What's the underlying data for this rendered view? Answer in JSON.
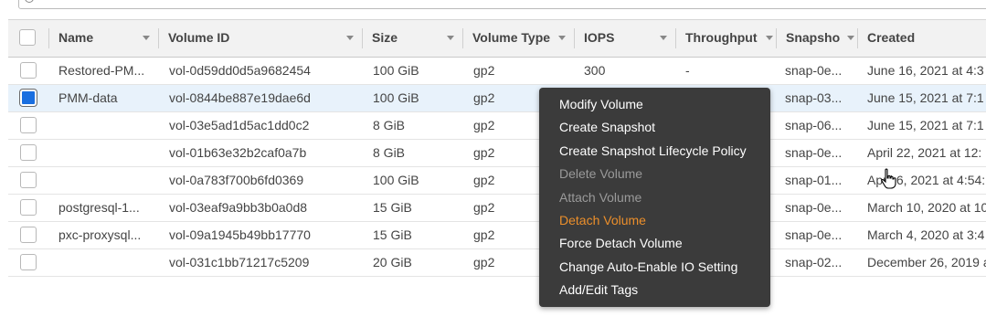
{
  "columns": [
    {
      "key": "name",
      "label": "Name"
    },
    {
      "key": "volume_id",
      "label": "Volume ID"
    },
    {
      "key": "size",
      "label": "Size"
    },
    {
      "key": "volume_type",
      "label": "Volume Type"
    },
    {
      "key": "iops",
      "label": "IOPS"
    },
    {
      "key": "throughput",
      "label": "Throughput"
    },
    {
      "key": "snapshot",
      "label": "Snapsho"
    },
    {
      "key": "created",
      "label": "Created"
    }
  ],
  "rows": [
    {
      "name": "Restored-PM...",
      "volume_id": "vol-0d59dd0d5a9682454",
      "size": "100 GiB",
      "volume_type": "gp2",
      "iops": "300",
      "throughput": "-",
      "snapshot": "snap-0e...",
      "created": "June 16, 2021 at 4:3",
      "selected": false
    },
    {
      "name": "PMM-data",
      "volume_id": "vol-0844be887e19dae6d",
      "size": "100 GiB",
      "volume_type": "gp2",
      "iops": "",
      "throughput": "",
      "snapshot": "snap-03...",
      "created": "June 15, 2021 at 7:1",
      "selected": true
    },
    {
      "name": "",
      "volume_id": "vol-03e5ad1d5ac1dd0c2",
      "size": "8 GiB",
      "volume_type": "gp2",
      "iops": "",
      "throughput": "",
      "snapshot": "snap-06...",
      "created": "June 15, 2021 at 7:1",
      "selected": false
    },
    {
      "name": "",
      "volume_id": "vol-01b63e32b2caf0a7b",
      "size": "8 GiB",
      "volume_type": "gp2",
      "iops": "",
      "throughput": "",
      "snapshot": "snap-0e...",
      "created": "April 22, 2021 at 12:",
      "selected": false
    },
    {
      "name": "",
      "volume_id": "vol-0a783f700b6fd0369",
      "size": "100 GiB",
      "volume_type": "gp2",
      "iops": "",
      "throughput": "",
      "snapshot": "snap-01...",
      "created": "April 6, 2021 at 4:54:",
      "selected": false
    },
    {
      "name": "postgresql-1...",
      "volume_id": "vol-03eaf9a9bb3b0a0d8",
      "size": "15 GiB",
      "volume_type": "gp2",
      "iops": "",
      "throughput": "",
      "snapshot": "snap-0e...",
      "created": "March 10, 2020 at 10",
      "selected": false
    },
    {
      "name": "pxc-proxysql...",
      "volume_id": "vol-09a1945b49bb17770",
      "size": "15 GiB",
      "volume_type": "gp2",
      "iops": "",
      "throughput": "",
      "snapshot": "snap-0e...",
      "created": "March 4, 2020 at 3:4",
      "selected": false
    },
    {
      "name": "",
      "volume_id": "vol-031c1bb71217c5209",
      "size": "20 GiB",
      "volume_type": "gp2",
      "iops": "",
      "throughput": "",
      "snapshot": "snap-02...",
      "created": "December 26, 2019 a",
      "selected": false
    }
  ],
  "context_menu": {
    "items": [
      {
        "label": "Modify Volume",
        "state": "enabled"
      },
      {
        "label": "Create Snapshot",
        "state": "enabled"
      },
      {
        "label": "Create Snapshot Lifecycle Policy",
        "state": "enabled"
      },
      {
        "label": "Delete Volume",
        "state": "disabled"
      },
      {
        "label": "Attach Volume",
        "state": "disabled"
      },
      {
        "label": "Detach Volume",
        "state": "highlighted"
      },
      {
        "label": "Force Detach Volume",
        "state": "enabled"
      },
      {
        "label": "Change Auto-Enable IO Setting",
        "state": "enabled"
      },
      {
        "label": "Add/Edit Tags",
        "state": "enabled"
      }
    ]
  },
  "colors": {
    "selected_row": "#e8f2fb",
    "checkbox_checked": "#1a6fe0",
    "menu_bg": "#3b3b3b",
    "menu_highlight": "#ec8f2b"
  },
  "icons": {
    "search": "search-icon",
    "cursor": "hand-pointer-icon"
  }
}
